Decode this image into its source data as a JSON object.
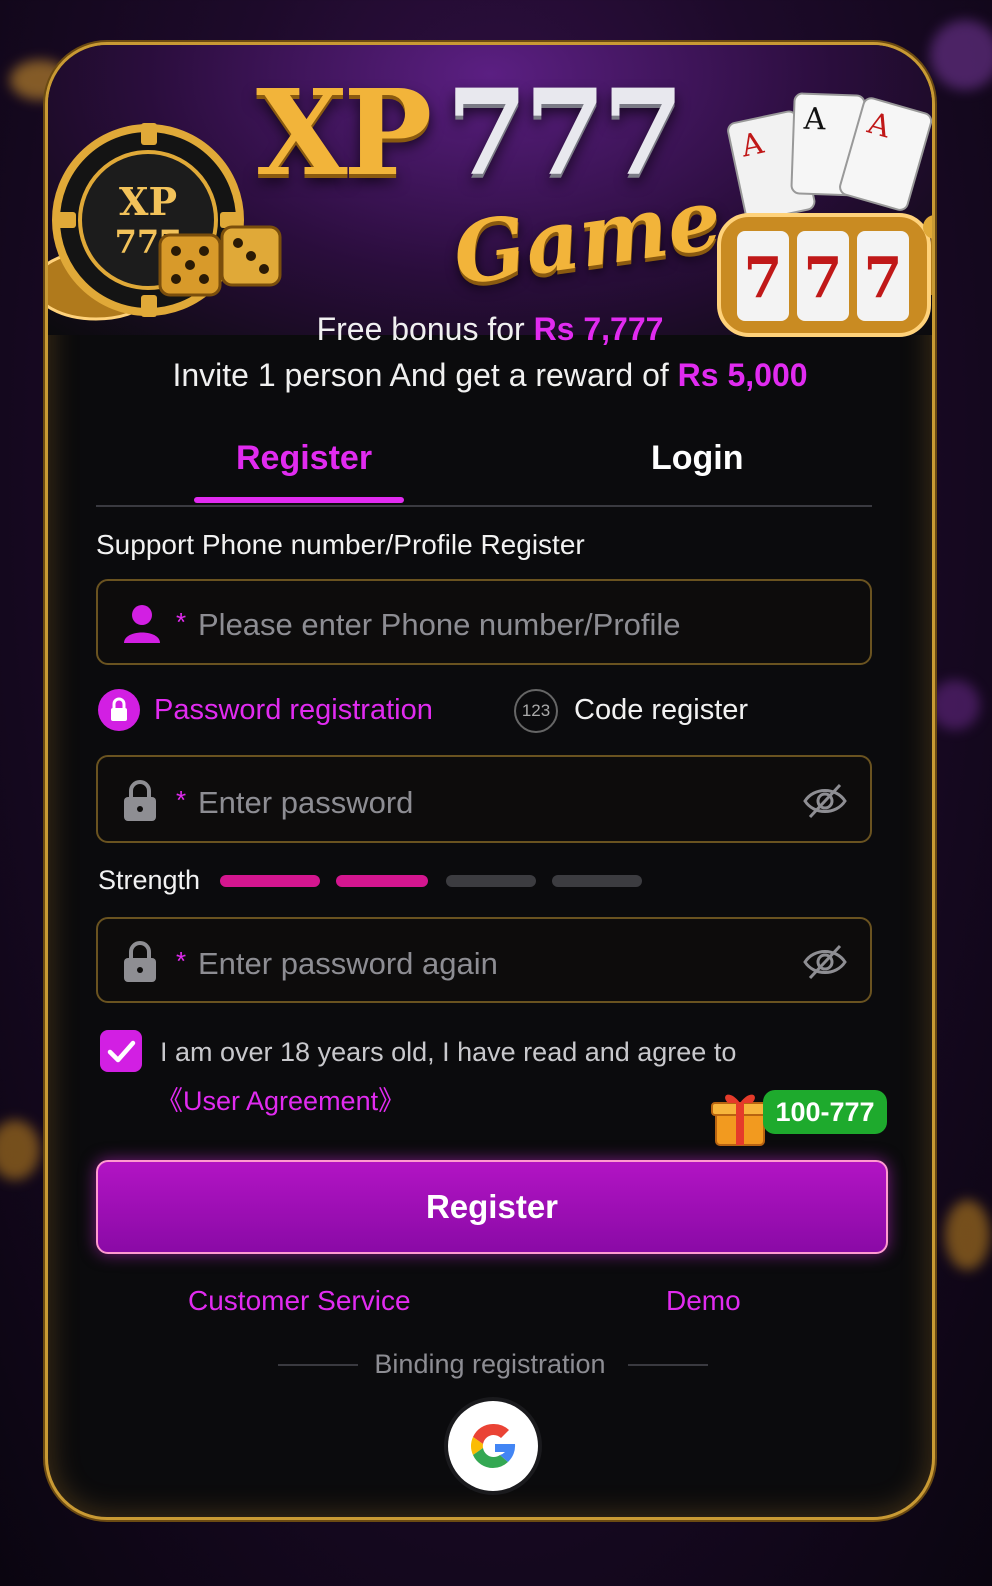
{
  "brand": {
    "logo_primary": "XP777",
    "logo_secondary": "Game",
    "chip_text_1": "XP",
    "chip_text_2": "777",
    "slot_digits": [
      "7",
      "7",
      "7"
    ]
  },
  "promo": {
    "line1_prefix": "Free bonus for",
    "line1_amount": "Rs 7,777",
    "line2_prefix": "Invite 1 person And get a reward of",
    "line2_amount": "Rs 5,000"
  },
  "tabs": {
    "register": "Register",
    "login": "Login",
    "active": "register"
  },
  "form": {
    "support_label": "Support Phone number/Profile Register",
    "phone_placeholder": "Please enter Phone number/Profile",
    "required_mark": "*",
    "method_password": "Password registration",
    "method_code_icon": "123",
    "method_code": "Code register",
    "password_placeholder": "Enter password",
    "strength_label": "Strength",
    "strength_level": 2,
    "strength_max": 4,
    "password_again_placeholder": "Enter password again",
    "agree_checked": true,
    "agree_text": "I am over 18 years old, I have read and agree to",
    "agree_link": "《User Agreement》",
    "bonus_badge": "100-777",
    "submit_label": "Register"
  },
  "footer": {
    "customer_service": "Customer Service",
    "demo": "Demo",
    "binding_label": "Binding registration"
  },
  "colors": {
    "accent": "#e12bf0",
    "gold": "#c99a34",
    "badge_green": "#1eaa2d",
    "strength_active": "#d4168f",
    "strength_inactive": "#3c3c40"
  }
}
